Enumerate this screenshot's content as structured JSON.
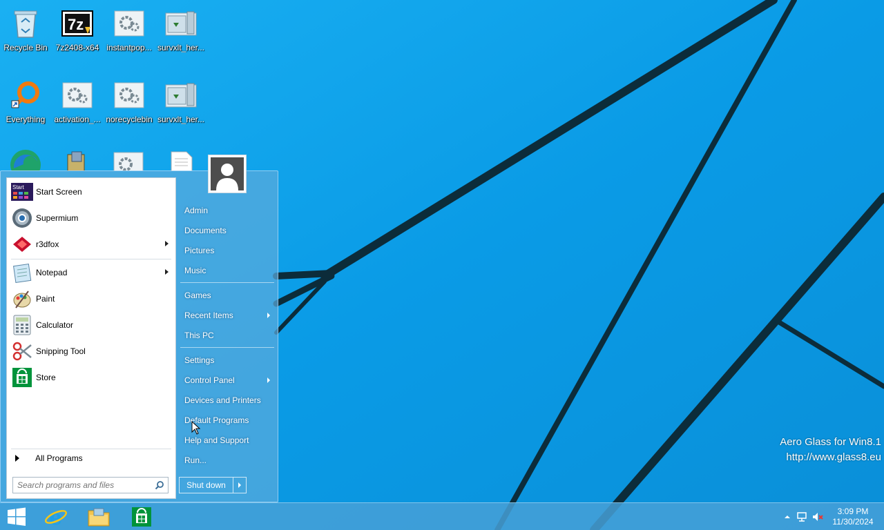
{
  "desktop": {
    "icons": [
      {
        "label": "Recycle Bin",
        "icon": "recycle-bin-icon"
      },
      {
        "label": "7z2408-x64",
        "icon": "7zip-icon"
      },
      {
        "label": "instantpop...",
        "icon": "setup-gear-icon"
      },
      {
        "label": "survxlt_her...",
        "icon": "installer-icon"
      },
      {
        "label": "Everything",
        "icon": "everything-search-icon"
      },
      {
        "label": "activation_...",
        "icon": "setup-gear-icon"
      },
      {
        "label": "norecyclebin",
        "icon": "setup-gear-icon"
      },
      {
        "label": "survxlt_her...",
        "icon": "installer-icon"
      }
    ],
    "watermark": {
      "line1": "Aero Glass for Win8.1",
      "line2": "http://www.glass8.eu"
    }
  },
  "start_menu": {
    "programs": [
      {
        "label": "Start Screen",
        "icon": "start-screen-icon",
        "has_submenu": false
      },
      {
        "label": "Supermium",
        "icon": "supermium-browser-icon",
        "has_submenu": false
      },
      {
        "label": "r3dfox",
        "icon": "r3dfox-icon",
        "has_submenu": true
      },
      {
        "label": "Notepad",
        "icon": "notepad-icon",
        "has_submenu": true
      },
      {
        "label": "Paint",
        "icon": "paint-icon",
        "has_submenu": false
      },
      {
        "label": "Calculator",
        "icon": "calculator-icon",
        "has_submenu": false
      },
      {
        "label": "Snipping Tool",
        "icon": "scissors-icon",
        "has_submenu": false
      },
      {
        "label": "Store",
        "icon": "store-icon",
        "has_submenu": false
      }
    ],
    "all_programs": "All Programs",
    "search_placeholder": "Search programs and files",
    "right_items": [
      {
        "label": "Admin",
        "has_submenu": false
      },
      {
        "label": "Documents",
        "has_submenu": false
      },
      {
        "label": "Pictures",
        "has_submenu": false
      },
      {
        "label": "Music",
        "has_submenu": false
      },
      {
        "label": "Games",
        "has_submenu": false
      },
      {
        "label": "Recent Items",
        "has_submenu": true
      },
      {
        "label": "This PC",
        "has_submenu": false
      },
      {
        "label": "Settings",
        "has_submenu": false
      },
      {
        "label": "Control Panel",
        "has_submenu": true
      },
      {
        "label": "Devices and Printers",
        "has_submenu": false
      },
      {
        "label": "Default Programs",
        "has_submenu": false
      },
      {
        "label": "Help and Support",
        "has_submenu": false
      },
      {
        "label": "Run...",
        "has_submenu": false
      }
    ],
    "shutdown_label": "Shut down"
  },
  "taskbar": {
    "pinned": [
      "start-button",
      "internet-explorer-icon",
      "file-explorer-icon",
      "store-icon"
    ],
    "clock": {
      "time": "3:09 PM",
      "date": "11/30/2024"
    }
  },
  "colors": {
    "wallpaper": "#0a9be6",
    "accent": "#46a0d7"
  }
}
